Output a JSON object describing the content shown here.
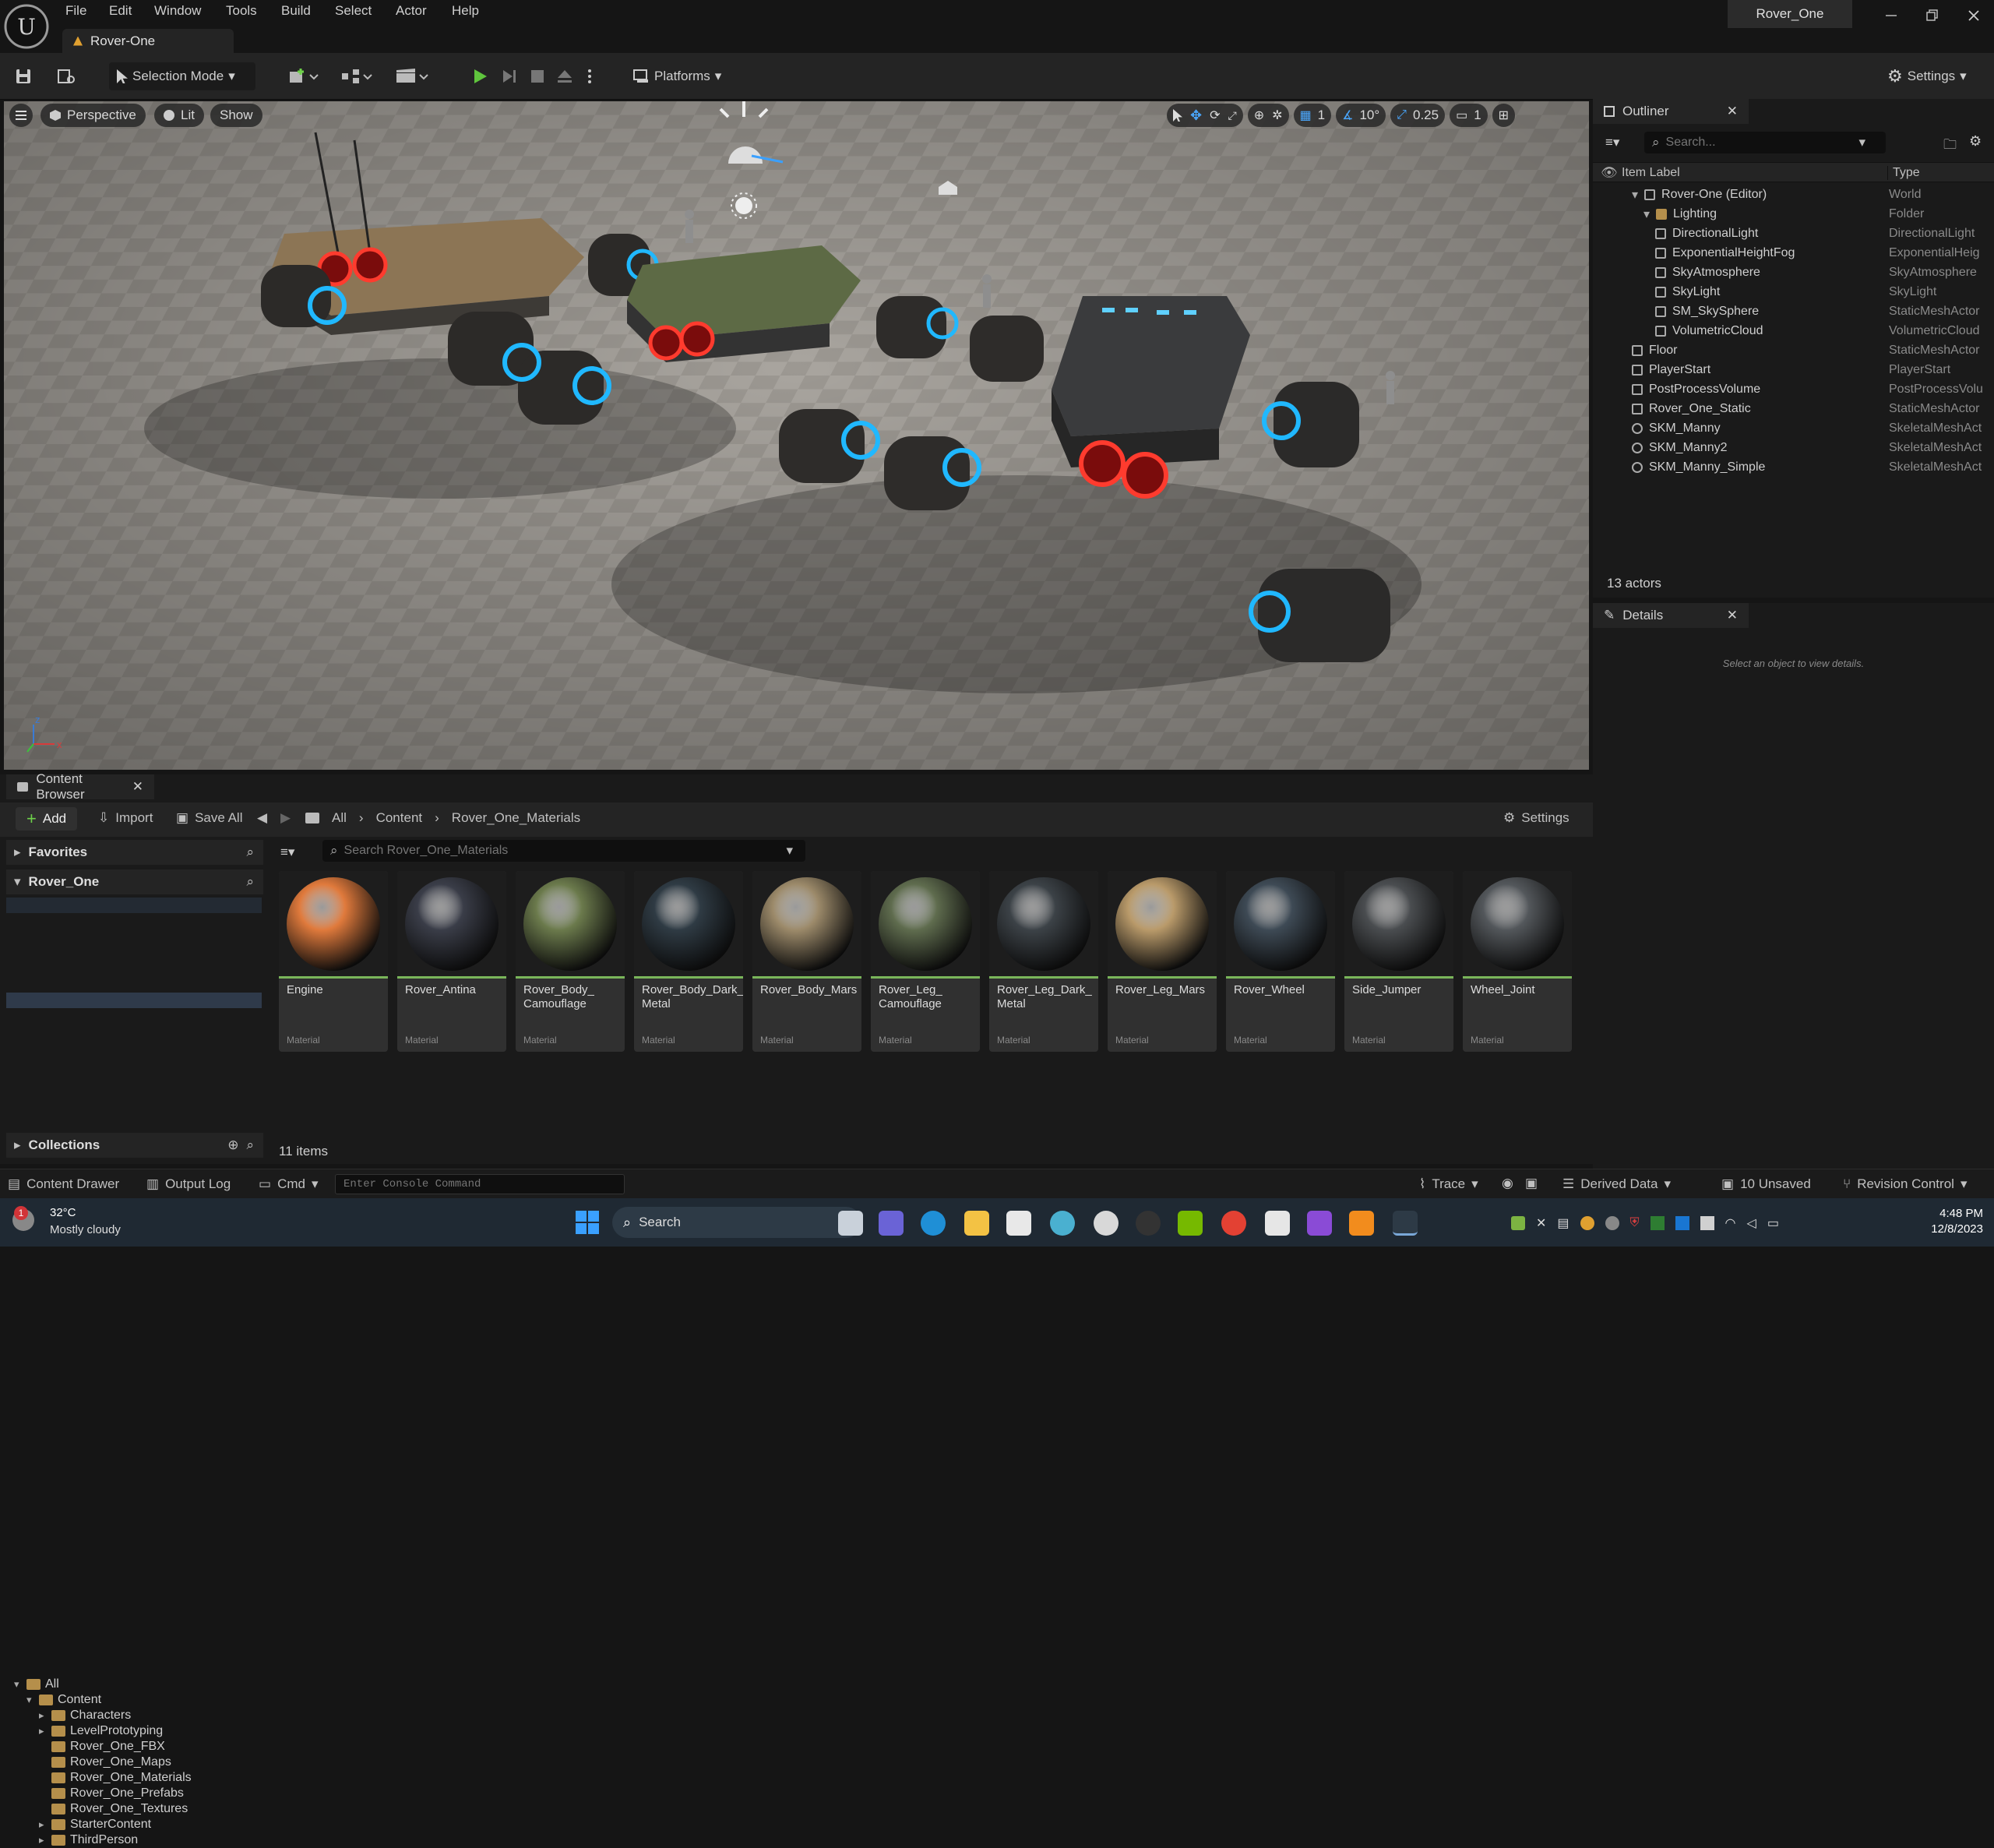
{
  "window": {
    "title": "Rover_One",
    "level_tab": "Rover-One"
  },
  "menu": [
    "File",
    "Edit",
    "Window",
    "Tools",
    "Build",
    "Select",
    "Actor",
    "Help"
  ],
  "toolbar": {
    "mode": "Selection Mode",
    "platforms": "Platforms",
    "settings": "Settings"
  },
  "viewport": {
    "perspective": "Perspective",
    "lit": "Lit",
    "show": "Show",
    "grid_value": "1",
    "rotation_value": "10°",
    "scale_value": "0.25",
    "camera_speed": "1"
  },
  "outliner": {
    "tab": "Outliner",
    "search_placeholder": "Search...",
    "col_label": "Item Label",
    "col_type": "Type",
    "rows": [
      {
        "label": "Rover-One (Editor)",
        "type": "World"
      },
      {
        "label": "Lighting",
        "type": "Folder"
      },
      {
        "label": "DirectionalLight",
        "type": "DirectionalLight"
      },
      {
        "label": "ExponentialHeightFog",
        "type": "ExponentialHeig"
      },
      {
        "label": "SkyAtmosphere",
        "type": "SkyAtmosphere"
      },
      {
        "label": "SkyLight",
        "type": "SkyLight"
      },
      {
        "label": "SM_SkySphere",
        "type": "StaticMeshActor"
      },
      {
        "label": "VolumetricCloud",
        "type": "VolumetricCloud"
      },
      {
        "label": "Floor",
        "type": "StaticMeshActor"
      },
      {
        "label": "PlayerStart",
        "type": "PlayerStart"
      },
      {
        "label": "PostProcessVolume",
        "type": "PostProcessVolu"
      },
      {
        "label": "Rover_One_Static",
        "type": "StaticMeshActor"
      },
      {
        "label": "SKM_Manny",
        "type": "SkeletalMeshAct"
      },
      {
        "label": "SKM_Manny2",
        "type": "SkeletalMeshAct"
      },
      {
        "label": "SKM_Manny_Simple",
        "type": "SkeletalMeshAct"
      }
    ],
    "count": "13 actors"
  },
  "details": {
    "tab": "Details",
    "empty": "Select an object to view details."
  },
  "content_browser": {
    "tab": "Content Browser",
    "add": "Add",
    "import": "Import",
    "save_all": "Save All",
    "breadcrumb": [
      "All",
      "Content",
      "Rover_One_Materials"
    ],
    "settings": "Settings",
    "favorites": "Favorites",
    "project": "Rover_One",
    "search_placeholder": "Search Rover_One_Materials",
    "tree": [
      "All",
      "Content",
      "Characters",
      "LevelPrototyping",
      "Rover_One_FBX",
      "Rover_One_Maps",
      "Rover_One_Materials",
      "Rover_One_Prefabs",
      "Rover_One_Textures",
      "StarterContent",
      "ThirdPerson"
    ],
    "collections": "Collections",
    "assets": [
      {
        "name": "Engine",
        "kind": "Material",
        "color": "#e07a3c"
      },
      {
        "name": "Rover_Antina",
        "kind": "Material",
        "color": "#3a3d48"
      },
      {
        "name": "Rover_Body_ Camouflage",
        "kind": "Material",
        "color": "#6b7a4c"
      },
      {
        "name": "Rover_Body_Dark_ Metal",
        "kind": "Material",
        "color": "#2f3b44"
      },
      {
        "name": "Rover_Body_Mars",
        "kind": "Material",
        "color": "#9c8a6a"
      },
      {
        "name": "Rover_Leg_ Camouflage",
        "kind": "Material",
        "color": "#5f6c4e"
      },
      {
        "name": "Rover_Leg_Dark_ Metal",
        "kind": "Material",
        "color": "#3c4247"
      },
      {
        "name": "Rover_Leg_Mars",
        "kind": "Material",
        "color": "#b99a6a"
      },
      {
        "name": "Rover_Wheel",
        "kind": "Material",
        "color": "#3e4a55"
      },
      {
        "name": "Side_Jumper",
        "kind": "Material",
        "color": "#4a4d50"
      },
      {
        "name": "Wheel_Joint",
        "kind": "Material",
        "color": "#53575b"
      }
    ],
    "item_count": "11 items"
  },
  "statusbar": {
    "content_drawer": "Content Drawer",
    "output_log": "Output Log",
    "cmd": "Cmd",
    "console_placeholder": "Enter Console Command",
    "trace": "Trace",
    "derived_data": "Derived Data",
    "unsaved": "10 Unsaved",
    "revision": "Revision Control"
  },
  "taskbar": {
    "weather_temp": "32°C",
    "weather_desc": "Mostly cloudy",
    "search": "Search",
    "time": "4:48 PM",
    "date": "12/8/2023",
    "weather_badge": "1"
  }
}
